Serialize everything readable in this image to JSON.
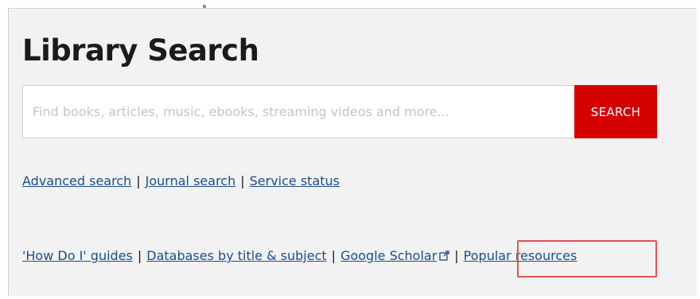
{
  "page": {
    "title": "Library Search"
  },
  "search": {
    "placeholder": "Find books, articles, music, ebooks, streaming videos and more...",
    "value": "",
    "button_label": "SEARCH"
  },
  "links_row1": [
    {
      "label": "Advanced search"
    },
    {
      "label": "Journal search"
    },
    {
      "label": "Service status"
    }
  ],
  "links_row2": [
    {
      "label": "'How Do I' guides"
    },
    {
      "label": "Databases by title & subject"
    },
    {
      "label": "Google Scholar",
      "icon": "external-link-icon"
    },
    {
      "label": "Popular resources",
      "highlighted": true
    }
  ],
  "separator": "|",
  "colors": {
    "panel_bg": "#f2f2f2",
    "search_button_bg": "#d50000",
    "link": "#1a4f8a",
    "highlight_border": "#e05252"
  }
}
